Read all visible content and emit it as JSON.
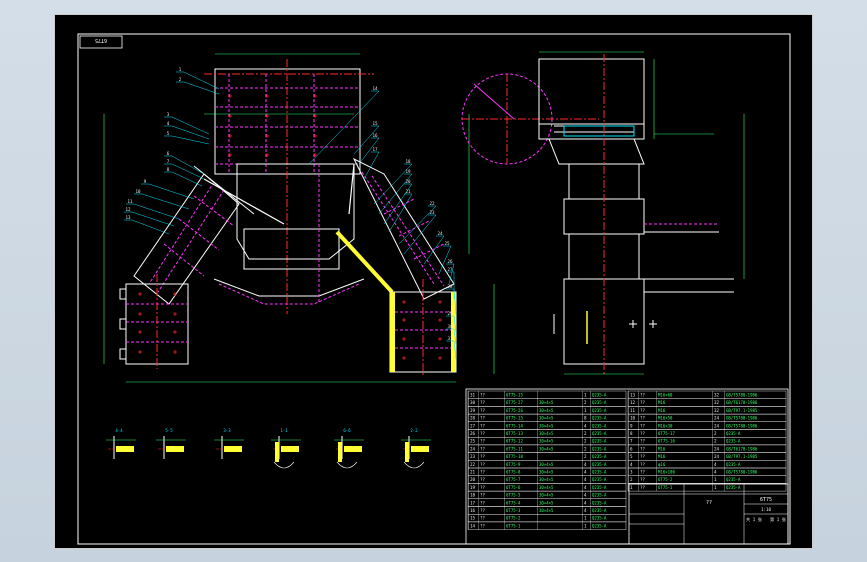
{
  "drawing": {
    "code": "6T75",
    "title_name": "??",
    "title_code": "6T75",
    "title_misc": [
      "1:10",
      "共 1 张",
      "第 1 张"
    ]
  },
  "balloons": [
    "1",
    "2",
    "3",
    "4",
    "5",
    "6",
    "7",
    "8",
    "9",
    "10",
    "11",
    "12",
    "13",
    "14",
    "15",
    "16",
    "17",
    "18",
    "19",
    "20",
    "21",
    "22",
    "23",
    "24",
    "25",
    "26",
    "27",
    "28",
    "29",
    "30",
    "31"
  ],
  "sections": [
    {
      "label": "4-4"
    },
    {
      "label": "5-5"
    },
    {
      "label": "3-3"
    },
    {
      "label": "1-1"
    },
    {
      "label": "6-6"
    },
    {
      "label": "2-2"
    }
  ],
  "bom_left": [
    {
      "no": "31",
      "code": "6T75-15",
      "name": "??",
      "spec": "",
      "qty": "1",
      "mat": "Q235-A"
    },
    {
      "no": "30",
      "code": "6T75-27",
      "name": "??",
      "spec": "30×4×5",
      "qty": "2",
      "mat": "Q235-A"
    },
    {
      "no": "29",
      "code": "6T75-26",
      "name": "??",
      "spec": "30×4×5",
      "qty": "1",
      "mat": "Q235-A"
    },
    {
      "no": "28",
      "code": "6T75-15",
      "name": "??",
      "spec": "30×4×5",
      "qty": "8",
      "mat": "Q235-A"
    },
    {
      "no": "27",
      "code": "6T75-14",
      "name": "??",
      "spec": "30×4×5",
      "qty": "4",
      "mat": "Q235-A"
    },
    {
      "no": "26",
      "code": "6T75-13",
      "name": "??",
      "spec": "30×4×5",
      "qty": "2",
      "mat": "Q235-A"
    },
    {
      "no": "25",
      "code": "6T75-12",
      "name": "??",
      "spec": "30×4×5",
      "qty": "2",
      "mat": "Q235-A"
    },
    {
      "no": "24",
      "code": "6T75-11",
      "name": "??",
      "spec": "30×4×5",
      "qty": "2",
      "mat": "Q235-A"
    },
    {
      "no": "23",
      "code": "6T75-10",
      "name": "??",
      "spec": "",
      "qty": "2",
      "mat": "Q235-A"
    },
    {
      "no": "22",
      "code": "6T75-9",
      "name": "??",
      "spec": "30×4×5",
      "qty": "4",
      "mat": "Q235-A"
    },
    {
      "no": "21",
      "code": "6T75-8",
      "name": "??",
      "spec": "30×4×5",
      "qty": "4",
      "mat": "Q235-A"
    },
    {
      "no": "20",
      "code": "6T75-7",
      "name": "??",
      "spec": "30×4×5",
      "qty": "4",
      "mat": "Q235-A"
    },
    {
      "no": "19",
      "code": "6T75-6",
      "name": "??",
      "spec": "30×4×5",
      "qty": "4",
      "mat": "Q235-A"
    },
    {
      "no": "18",
      "code": "6T75-5",
      "name": "??",
      "spec": "30×4×5",
      "qty": "4",
      "mat": "Q235-A"
    },
    {
      "no": "17",
      "code": "6T75-4",
      "name": "??",
      "spec": "30×4×5",
      "qty": "4",
      "mat": "Q235-A"
    },
    {
      "no": "16",
      "code": "6T75-3",
      "name": "??",
      "spec": "30×4×5",
      "qty": "4",
      "mat": "Q235-A"
    },
    {
      "no": "15",
      "code": "6T75-2",
      "name": "??",
      "spec": "",
      "qty": "1",
      "mat": "Q235-A"
    },
    {
      "no": "14",
      "code": "6T75-1",
      "name": "??",
      "spec": "",
      "qty": "1",
      "mat": "Q235-A"
    }
  ],
  "bom_right": [
    {
      "no": "13",
      "code": "M16×60",
      "name": "??",
      "qty": "32",
      "mat": "GB/T5780-1986"
    },
    {
      "no": "12",
      "code": "M16",
      "name": "??",
      "qty": "32",
      "mat": "GB/T6170-1986"
    },
    {
      "no": "11",
      "code": "M16",
      "name": "??",
      "qty": "32",
      "mat": "GB/T97.1-1985"
    },
    {
      "no": "10",
      "code": "M16×50",
      "name": "??",
      "qty": "24",
      "mat": "GB/T5780-1986"
    },
    {
      "no": "9",
      "code": "M16×30",
      "name": "??",
      "qty": "24",
      "mat": "GB/T5780-1986"
    },
    {
      "no": "8",
      "code": "6T75-17",
      "name": "??",
      "qty": "2",
      "mat": "Q235-A"
    },
    {
      "no": "7",
      "code": "6T75-16",
      "name": "??",
      "qty": "2",
      "mat": "Q235-A"
    },
    {
      "no": "6",
      "code": "M16",
      "name": "??",
      "qty": "24",
      "mat": "GB/T6170-1986"
    },
    {
      "no": "5",
      "code": "M16",
      "name": "??",
      "qty": "24",
      "mat": "GB/T97.1-1985"
    },
    {
      "no": "4",
      "code": "φ16",
      "name": "??",
      "qty": "4",
      "mat": "Q235-A"
    },
    {
      "no": "3",
      "code": "M16×100",
      "name": "??",
      "qty": "4",
      "mat": "GB/T5780-1986"
    },
    {
      "no": "2",
      "code": "6T75-2",
      "name": "??",
      "qty": "1",
      "mat": "Q235-A"
    },
    {
      "no": "1",
      "code": "6T75-1",
      "name": "??",
      "qty": "1",
      "mat": "Q235-A"
    }
  ],
  "colors": {
    "outline": "#ffffff",
    "hidden": "#ff33ff",
    "center": "#ff2a2a",
    "dim": "#33ff66",
    "weld": "#ffff33",
    "leader": "#00e5ff",
    "border": "#ffffff"
  }
}
